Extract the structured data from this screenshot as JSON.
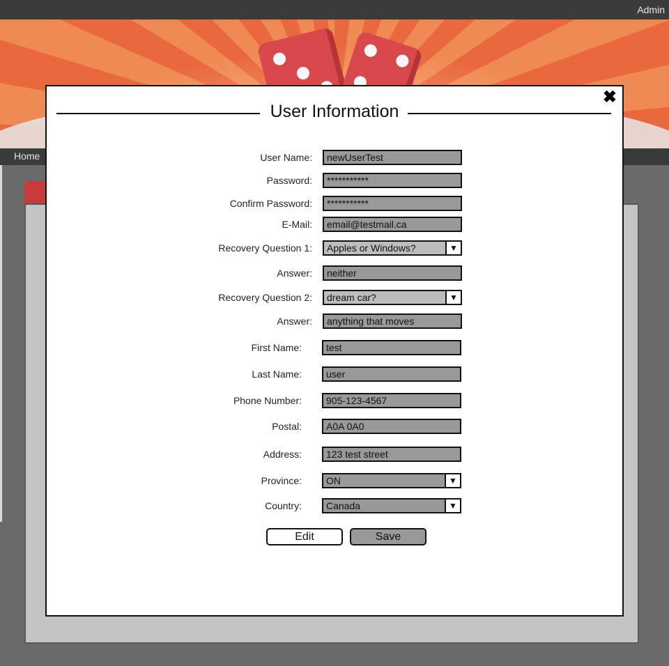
{
  "header": {
    "admin_label": "Admin"
  },
  "nav": {
    "home_label": "Home"
  },
  "modal": {
    "title": "User Information",
    "close_icon": "close-icon",
    "fields": {
      "user_name": {
        "label": "User Name:",
        "value": "newUserTest"
      },
      "password": {
        "label": "Password:",
        "value": "***********"
      },
      "confirm_password": {
        "label": "Confirm Password:",
        "value": "***********"
      },
      "email": {
        "label": "E-Mail:",
        "value": "email@testmail.ca"
      },
      "recovery_question_1": {
        "label": "Recovery Question 1:",
        "value": "Apples or Windows?"
      },
      "answer_1": {
        "label": "Answer:",
        "value": "neither"
      },
      "recovery_question_2": {
        "label": "Recovery Question 2:",
        "value": "dream car?"
      },
      "answer_2": {
        "label": "Answer:",
        "value": "anything that moves"
      },
      "first_name": {
        "label": "First Name:",
        "value": "test"
      },
      "last_name": {
        "label": "Last Name:",
        "value": "user"
      },
      "phone_number": {
        "label": "Phone Number:",
        "value": "905-123-4567"
      },
      "postal": {
        "label": "Postal:",
        "value": "A0A 0A0"
      },
      "address": {
        "label": "Address:",
        "value": "123 test street"
      },
      "province": {
        "label": "Province:",
        "value": "ON"
      },
      "country": {
        "label": "Country:",
        "value": "Canada"
      }
    },
    "buttons": {
      "edit_label": "Edit",
      "save_label": "Save"
    },
    "dropdown_arrow": "▼"
  },
  "colors": {
    "topbar": "#3b3b3b",
    "banner_orange": "#e9683e",
    "field_bg": "#999999",
    "modal_border": "#111111"
  }
}
